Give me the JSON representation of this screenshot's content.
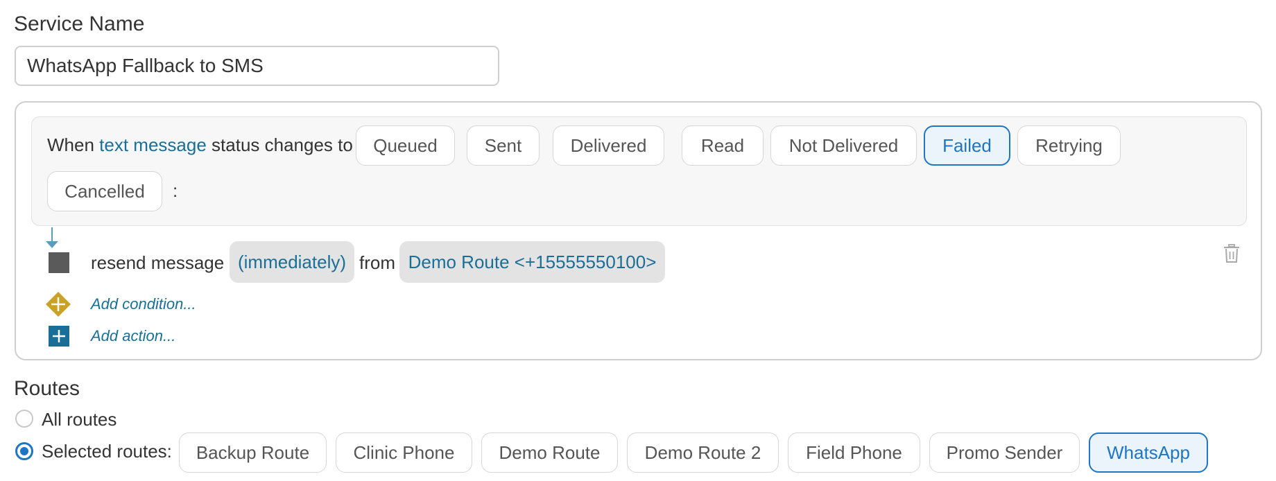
{
  "service_name": {
    "label": "Service Name",
    "value": "WhatsApp Fallback to SMS"
  },
  "trigger": {
    "prefix": "When",
    "message_type": "text message",
    "middle": "status changes to",
    "statuses": [
      {
        "label": "Queued",
        "selected": false
      },
      {
        "label": "Sent",
        "selected": false
      },
      {
        "label": "Delivered",
        "selected": false
      },
      {
        "label": "Read",
        "selected": false
      },
      {
        "label": "Not Delivered",
        "selected": false
      },
      {
        "label": "Failed",
        "selected": true
      },
      {
        "label": "Retrying",
        "selected": false
      },
      {
        "label": "Cancelled",
        "selected": false
      }
    ],
    "suffix": ":"
  },
  "action": {
    "text": "resend message",
    "timing": "(immediately)",
    "from_text": "from",
    "route": "Demo Route <+15555550100>"
  },
  "add_condition_label": "Add condition...",
  "add_action_label": "Add action...",
  "routes": {
    "title": "Routes",
    "all_label": "All routes",
    "selected_label": "Selected routes:",
    "mode": "selected",
    "options": [
      {
        "label": "Backup Route",
        "selected": false
      },
      {
        "label": "Clinic Phone",
        "selected": false
      },
      {
        "label": "Demo Route",
        "selected": false
      },
      {
        "label": "Demo Route 2",
        "selected": false
      },
      {
        "label": "Field Phone",
        "selected": false
      },
      {
        "label": "Promo Sender",
        "selected": false
      },
      {
        "label": "WhatsApp",
        "selected": true
      }
    ]
  },
  "colors": {
    "accent": "#1d75c4",
    "link": "#1a6f96",
    "condition_icon": "#c9a227",
    "action_icon": "#1a6f96"
  },
  "icons": {
    "action_block": "square-block-icon",
    "condition_add": "diamond-plus-icon",
    "action_add": "square-plus-icon",
    "delete": "trash-icon"
  }
}
